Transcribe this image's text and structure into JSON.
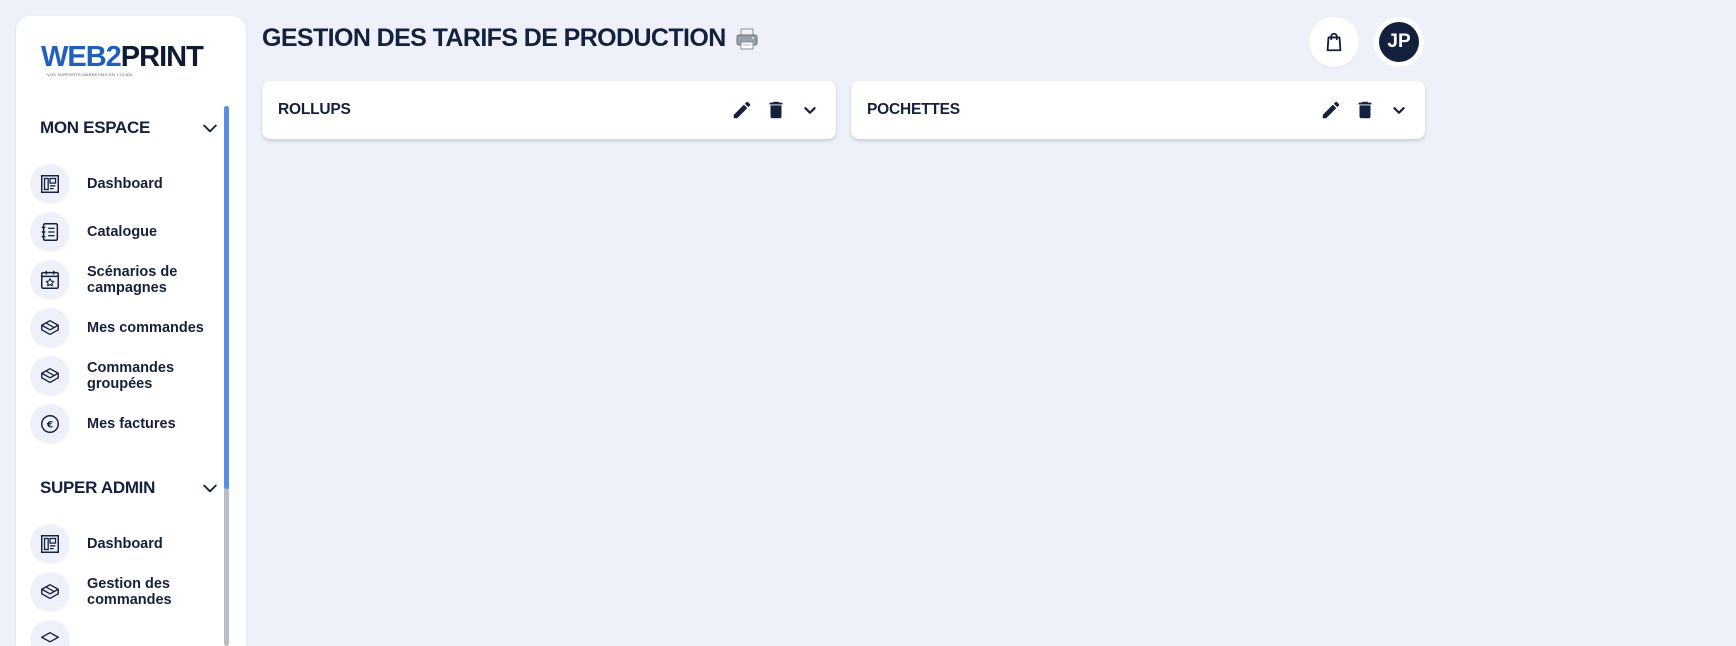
{
  "app": {
    "logo_part1": "WEB2",
    "logo_part2": "PRINT",
    "logo_tagline": "VOS SUPPORTS MARKETING EN 1 CLICK",
    "brand_color": "#1e5fbf",
    "primary_color": "#14213d"
  },
  "sidebar": {
    "sections": [
      {
        "title": "MON ESPACE",
        "items": [
          {
            "label": "Dashboard",
            "icon": "dashboard-icon"
          },
          {
            "label": "Catalogue",
            "icon": "catalog-icon"
          },
          {
            "label": "Scénarios de campagnes",
            "icon": "campaign-icon"
          },
          {
            "label": "Mes commandes",
            "icon": "box-icon"
          },
          {
            "label": "Commandes groupées",
            "icon": "box-icon"
          },
          {
            "label": "Mes factures",
            "icon": "euro-icon"
          }
        ]
      },
      {
        "title": "SUPER ADMIN",
        "items": [
          {
            "label": "Dashboard",
            "icon": "dashboard-icon"
          },
          {
            "label": "Gestion des commandes",
            "icon": "box-icon"
          }
        ]
      }
    ]
  },
  "header": {
    "title": "GESTION DES TARIFS DE PRODUCTION",
    "title_icon": "printer-icon",
    "avatar_initials": "JP"
  },
  "cards": [
    {
      "title": "ROLLUPS"
    },
    {
      "title": "POCHETTES"
    }
  ]
}
